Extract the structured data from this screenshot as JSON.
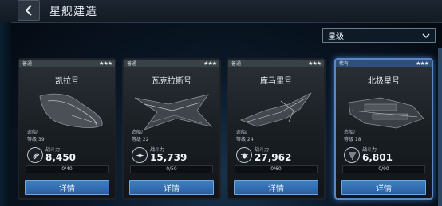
{
  "header": {
    "title": "星舰建造"
  },
  "filter": {
    "value": "星级"
  },
  "ships": [
    {
      "rarity": "普通",
      "stars": "★★★",
      "name": "凯拉号",
      "shipyard_label": "造船厂",
      "level_label": "等级 39",
      "power_label": "战斗力",
      "power": "8,450",
      "progress_text": "0/40",
      "progress": 0,
      "button_label": "详情",
      "icon": "stripes-emblem-icon"
    },
    {
      "rarity": "普通",
      "stars": "★★★",
      "name": "瓦克拉斯号",
      "shipyard_label": "造船厂",
      "level_label": "等级 22",
      "power_label": "战斗力",
      "power": "15,739",
      "progress_text": "0/50",
      "progress": 0,
      "button_label": "详情",
      "icon": "star-emblem-icon"
    },
    {
      "rarity": "普通",
      "stars": "★★★",
      "name": "库马里号",
      "shipyard_label": "造船厂",
      "level_label": "等级 24",
      "power_label": "战斗力",
      "power": "27,962",
      "progress_text": "0/60",
      "progress": 0,
      "button_label": "详情",
      "icon": "bug-emblem-icon"
    },
    {
      "rarity": "稀有",
      "stars": "★★★",
      "name": "北极星号",
      "shipyard_label": "造船厂",
      "level_label": "等级 18",
      "power_label": "战斗力",
      "power": "6,801",
      "progress_text": "0/90",
      "progress": 0,
      "button_label": "详情",
      "icon": "tornado-emblem-icon"
    }
  ],
  "colors": {
    "accent": "#3f7fc4",
    "rare_border": "#5a87c8"
  }
}
